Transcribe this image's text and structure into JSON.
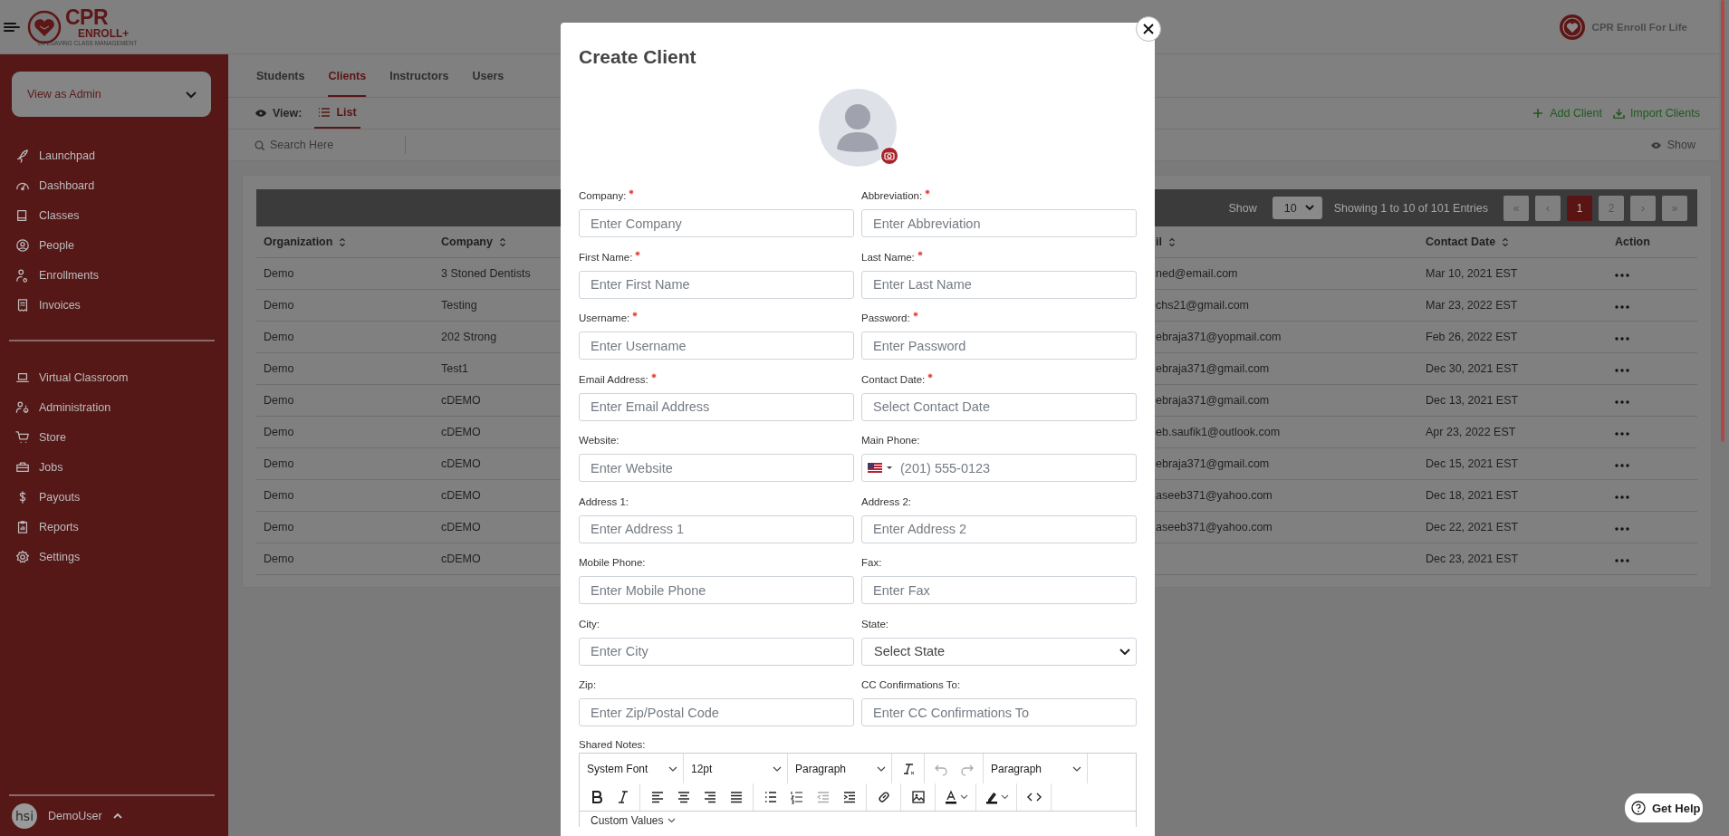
{
  "header": {
    "logo_title": "CPR",
    "logo_subtitle": "ENROLL+",
    "logo_tagline": "LIFESAVING CLASS MANAGEMENT",
    "brand": "CPR Enroll For Life"
  },
  "sidebar": {
    "role_select": "View as Admin",
    "groups": [
      {
        "items": [
          {
            "label": "Launchpad",
            "selected": false
          },
          {
            "label": "Dashboard",
            "selected": false
          },
          {
            "label": "Classes",
            "selected": false
          },
          {
            "label": "People",
            "selected": false
          },
          {
            "label": "Enrollments",
            "selected": false
          },
          {
            "label": "Invoices",
            "selected": false
          }
        ]
      },
      {
        "items": [
          {
            "label": "Virtual Classroom",
            "selected": false
          },
          {
            "label": "Administration",
            "selected": false
          },
          {
            "label": "Store",
            "selected": false
          },
          {
            "label": "Jobs",
            "selected": false
          },
          {
            "label": "Payouts",
            "selected": false
          },
          {
            "label": "Reports",
            "selected": false
          },
          {
            "label": "Settings",
            "selected": false
          }
        ]
      }
    ],
    "user": {
      "avatar": "hsi",
      "name": "DemoUser"
    }
  },
  "tabs": [
    {
      "label": "Students",
      "selected": false
    },
    {
      "label": "Clients",
      "selected": true
    },
    {
      "label": "Instructors",
      "selected": false
    },
    {
      "label": "Users",
      "selected": false
    }
  ],
  "view": {
    "label": "View:",
    "options": [
      {
        "label": "List",
        "selected": true
      }
    ]
  },
  "actions": [
    "Add Client",
    "Import Clients"
  ],
  "search": {
    "placeholder": "Search Here"
  },
  "column_toggle": "Show",
  "table": {
    "show_label": "Show",
    "page_size": "10",
    "summary": "Showing 1 to 10 of 101 Entries",
    "pages": [
      {
        "label": "«",
        "selected": false
      },
      {
        "label": "‹",
        "selected": false
      },
      {
        "label": "1",
        "selected": true
      },
      {
        "label": "2",
        "selected": false
      },
      {
        "label": "›",
        "selected": false
      },
      {
        "label": "»",
        "selected": false
      }
    ],
    "columns": [
      {
        "label": "Organization",
        "sortable": true
      },
      {
        "label": "Company",
        "sortable": true
      },
      {
        "label": "il",
        "sortable": true
      },
      {
        "label": "Contact Date",
        "sortable": true
      },
      {
        "label": "Action",
        "sortable": false
      }
    ],
    "rows": [
      {
        "organization": "Demo",
        "company": "3 Stoned Dentists",
        "email": "ned@email.com",
        "contact_date": "Mar 10, 2021 EST"
      },
      {
        "organization": "Demo",
        "company": "Testing",
        "email": "chs21@gmail.com",
        "contact_date": "Mar 23, 2022 EST"
      },
      {
        "organization": "Demo",
        "company": "202 Strong",
        "email": "ebraja371@yopmail.com",
        "contact_date": "Feb 26, 2022 EST"
      },
      {
        "organization": "Demo",
        "company": "Test1",
        "email": "ebraja371@gmail.com",
        "contact_date": "Dec 30, 2021 EST"
      },
      {
        "organization": "Demo",
        "company": "cDEMO",
        "email": "ebraja371@gmail.com",
        "contact_date": "Dec 13, 2021 EST"
      },
      {
        "organization": "Demo",
        "company": "cDEMO",
        "email": "eb.saufik1@outlook.com",
        "contact_date": "Apr 23, 2022 EST"
      },
      {
        "organization": "Demo",
        "company": "cDEMO",
        "email": "ebraja371@gmail.com",
        "contact_date": "Dec 15, 2021 EST"
      },
      {
        "organization": "Demo",
        "company": "cDEMO",
        "email": "aseeb371@yahoo.com",
        "contact_date": "Dec 18, 2021 EST"
      },
      {
        "organization": "Demo",
        "company": "cDEMO",
        "email": "aseeb371@yahoo.com",
        "contact_date": "Dec 22, 2021 EST"
      },
      {
        "organization": "Demo",
        "company": "cDEMO",
        "contact_date": "Dec 23, 2021 EST"
      }
    ]
  },
  "modal": {
    "title": "Create Client",
    "fields": [
      {
        "kind": "text",
        "label": "Company:",
        "required": true,
        "placeholder": "Enter Company"
      },
      {
        "kind": "text",
        "label": "Abbreviation:",
        "required": true,
        "placeholder": "Enter Abbreviation"
      },
      {
        "kind": "text",
        "label": "First Name:",
        "required": true,
        "placeholder": "Enter First Name"
      },
      {
        "kind": "text",
        "label": "Last Name:",
        "required": true,
        "placeholder": "Enter Last Name"
      },
      {
        "kind": "text",
        "label": "Username:",
        "required": true,
        "placeholder": "Enter Username"
      },
      {
        "kind": "text",
        "label": "Password:",
        "required": true,
        "placeholder": "Enter Password"
      },
      {
        "kind": "text",
        "label": "Email Address:",
        "required": true,
        "placeholder": "Enter Email Address"
      },
      {
        "kind": "text",
        "label": "Contact Date:",
        "required": true,
        "placeholder": "Select Contact Date"
      },
      {
        "kind": "text",
        "label": "Website:",
        "required": false,
        "placeholder": "Enter Website"
      },
      {
        "kind": "phone",
        "label": "Main Phone:",
        "required": false,
        "placeholder": "(201) 555-0123"
      },
      {
        "kind": "text",
        "label": "Address 1:",
        "required": false,
        "placeholder": "Enter Address 1"
      },
      {
        "kind": "text",
        "label": "Address 2:",
        "required": false,
        "placeholder": "Enter Address 2"
      },
      {
        "kind": "text",
        "label": "Mobile Phone:",
        "required": false,
        "placeholder": "Enter Mobile Phone"
      },
      {
        "kind": "text",
        "label": "Fax:",
        "required": false,
        "placeholder": "Enter Fax"
      },
      {
        "kind": "text",
        "label": "City:",
        "required": false,
        "placeholder": "Enter City"
      },
      {
        "kind": "select",
        "label": "State:",
        "required": false,
        "placeholder": "Select State"
      },
      {
        "kind": "text",
        "label": "Zip:",
        "required": false,
        "placeholder": "Enter Zip/Postal Code"
      },
      {
        "kind": "text",
        "label": "CC Confirmations To:",
        "required": false,
        "placeholder": "Enter CC Confirmations To"
      }
    ],
    "notes": {
      "label": "Shared Notes:",
      "toolbar": [
        [
          [
            {
              "kind": "dropdown",
              "label": "System Font",
              "disabled": false
            }
          ],
          [
            {
              "kind": "dropdown",
              "label": "12pt",
              "disabled": false
            }
          ],
          [
            {
              "kind": "dropdown",
              "label": "Paragraph",
              "disabled": false
            }
          ],
          [
            {
              "kind": "clear",
              "disabled": false
            }
          ],
          [
            {
              "kind": "undo",
              "disabled": true
            },
            {
              "kind": "redo",
              "disabled": true
            }
          ],
          [
            {
              "kind": "dropdown",
              "label": "Paragraph",
              "disabled": false
            }
          ]
        ],
        [
          [
            {
              "kind": "bold",
              "disabled": false
            },
            {
              "kind": "italic",
              "disabled": false
            }
          ],
          [
            {
              "kind": "left",
              "disabled": false
            },
            {
              "kind": "center",
              "disabled": false
            },
            {
              "kind": "right",
              "disabled": false
            },
            {
              "kind": "justify",
              "disabled": false
            }
          ],
          [
            {
              "kind": "bullets",
              "disabled": false
            },
            {
              "kind": "numbers",
              "disabled": false
            },
            {
              "kind": "outdent",
              "disabled": true
            },
            {
              "kind": "indent",
              "disabled": false
            }
          ],
          [
            {
              "kind": "link",
              "disabled": false
            }
          ],
          [
            {
              "kind": "image",
              "disabled": false
            }
          ],
          [
            {
              "kind": "textcolor",
              "disabled": false
            }
          ],
          [
            {
              "kind": "highlight",
              "disabled": false
            }
          ],
          [
            {
              "kind": "code",
              "disabled": false
            }
          ]
        ]
      ],
      "menu": "Custom Values"
    }
  },
  "help": "Get Help"
}
